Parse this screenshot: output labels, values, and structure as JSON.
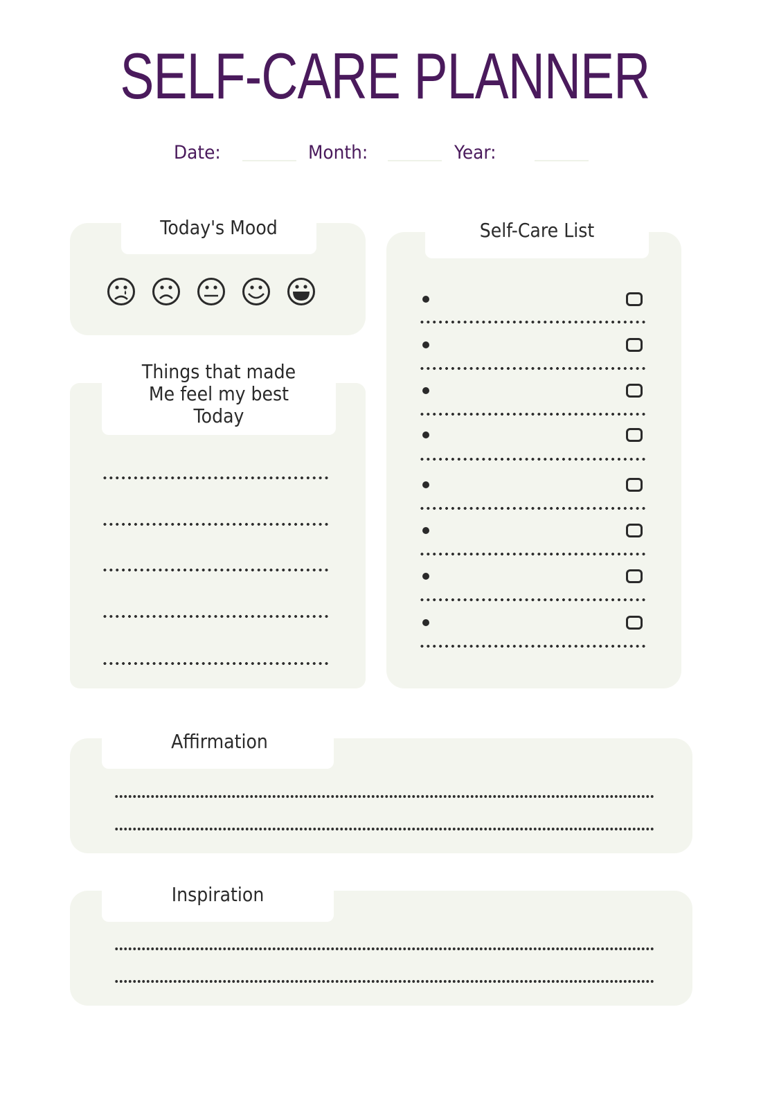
{
  "header": {
    "title": "SELF-CARE PLANNER",
    "accent_color": "#4a1a5c"
  },
  "date_fields": {
    "date_label": "Date:",
    "date_value": "",
    "month_label": "Month:",
    "month_value": "",
    "year_label": "Year:",
    "year_value": ""
  },
  "mood": {
    "title": "Today's Mood",
    "faces": [
      {
        "icon": "crying-face-icon",
        "meaning": "very sad"
      },
      {
        "icon": "frowning-face-icon",
        "meaning": "sad"
      },
      {
        "icon": "neutral-face-icon",
        "meaning": "neutral"
      },
      {
        "icon": "smiling-face-icon",
        "meaning": "happy"
      },
      {
        "icon": "grinning-face-icon",
        "meaning": "very happy"
      }
    ]
  },
  "things_best": {
    "title_line1": "Things that made",
    "title_line2": "Me feel my best",
    "title_line3": "Today",
    "lines": [
      "",
      "",
      "",
      "",
      ""
    ]
  },
  "self_care_list": {
    "title": "Self-Care List",
    "items": [
      {
        "text": "",
        "checked": false
      },
      {
        "text": "",
        "checked": false
      },
      {
        "text": "",
        "checked": false
      },
      {
        "text": "",
        "checked": false
      },
      {
        "text": "",
        "checked": false
      },
      {
        "text": "",
        "checked": false
      },
      {
        "text": "",
        "checked": false
      },
      {
        "text": "",
        "checked": false
      }
    ]
  },
  "affirmation": {
    "title": "Affirmation",
    "lines": [
      "",
      ""
    ]
  },
  "inspiration": {
    "title": "Inspiration",
    "lines": [
      "",
      ""
    ]
  },
  "colors": {
    "panel_bg": "#f3f5ee",
    "text": "#2a2a2a",
    "accent": "#4a1a5c"
  }
}
